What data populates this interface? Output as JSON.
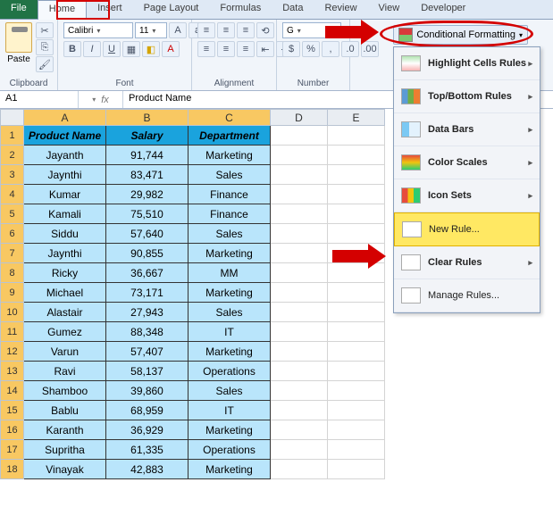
{
  "tabs": {
    "file": "File",
    "home": "Home",
    "insert": "Insert",
    "pagelayout": "Page Layout",
    "formulas": "Formulas",
    "data": "Data",
    "review": "Review",
    "view": "View",
    "developer": "Developer"
  },
  "ribbon": {
    "paste": "Paste",
    "clipboard": "Clipboard",
    "fontname": "Calibri",
    "fontsize": "11",
    "fontgroup": "Font",
    "alignment": "Alignment",
    "number": "Number",
    "general": "G",
    "cf": "Conditional Formatting"
  },
  "menu": {
    "highlight": "Highlight Cells Rules",
    "topbottom": "Top/Bottom Rules",
    "databars": "Data Bars",
    "colorscales": "Color Scales",
    "iconsets": "Icon Sets",
    "newrule": "New Rule...",
    "clearrules": "Clear Rules",
    "managerules": "Manage Rules..."
  },
  "fbar": {
    "name": "A1",
    "fx": "fx",
    "formula": "Product Name"
  },
  "cols": [
    "A",
    "B",
    "C",
    "D",
    "E"
  ],
  "headers": [
    "Product Name",
    "Salary",
    "Department"
  ],
  "chart_data": {
    "type": "table",
    "columns": [
      "Product Name",
      "Salary",
      "Department"
    ],
    "rows": [
      [
        "Jayanth",
        "91,744",
        "Marketing"
      ],
      [
        "Jaynthi",
        "83,471",
        "Sales"
      ],
      [
        "Kumar",
        "29,982",
        "Finance"
      ],
      [
        "Kamali",
        "75,510",
        "Finance"
      ],
      [
        "Siddu",
        "57,640",
        "Sales"
      ],
      [
        "Jaynthi",
        "90,855",
        "Marketing"
      ],
      [
        "Ricky",
        "36,667",
        "MM"
      ],
      [
        "Michael",
        "73,171",
        "Marketing"
      ],
      [
        "Alastair",
        "27,943",
        "Sales"
      ],
      [
        "Gumez",
        "88,348",
        "IT"
      ],
      [
        "Varun",
        "57,407",
        "Marketing"
      ],
      [
        "Ravi",
        "58,137",
        "Operations"
      ],
      [
        "Shamboo",
        "39,860",
        "Sales"
      ],
      [
        "Bablu",
        "68,959",
        "IT"
      ],
      [
        "Karanth",
        "36,929",
        "Marketing"
      ],
      [
        "Supritha",
        "61,335",
        "Operations"
      ],
      [
        "Vinayak",
        "42,883",
        "Marketing"
      ]
    ]
  }
}
